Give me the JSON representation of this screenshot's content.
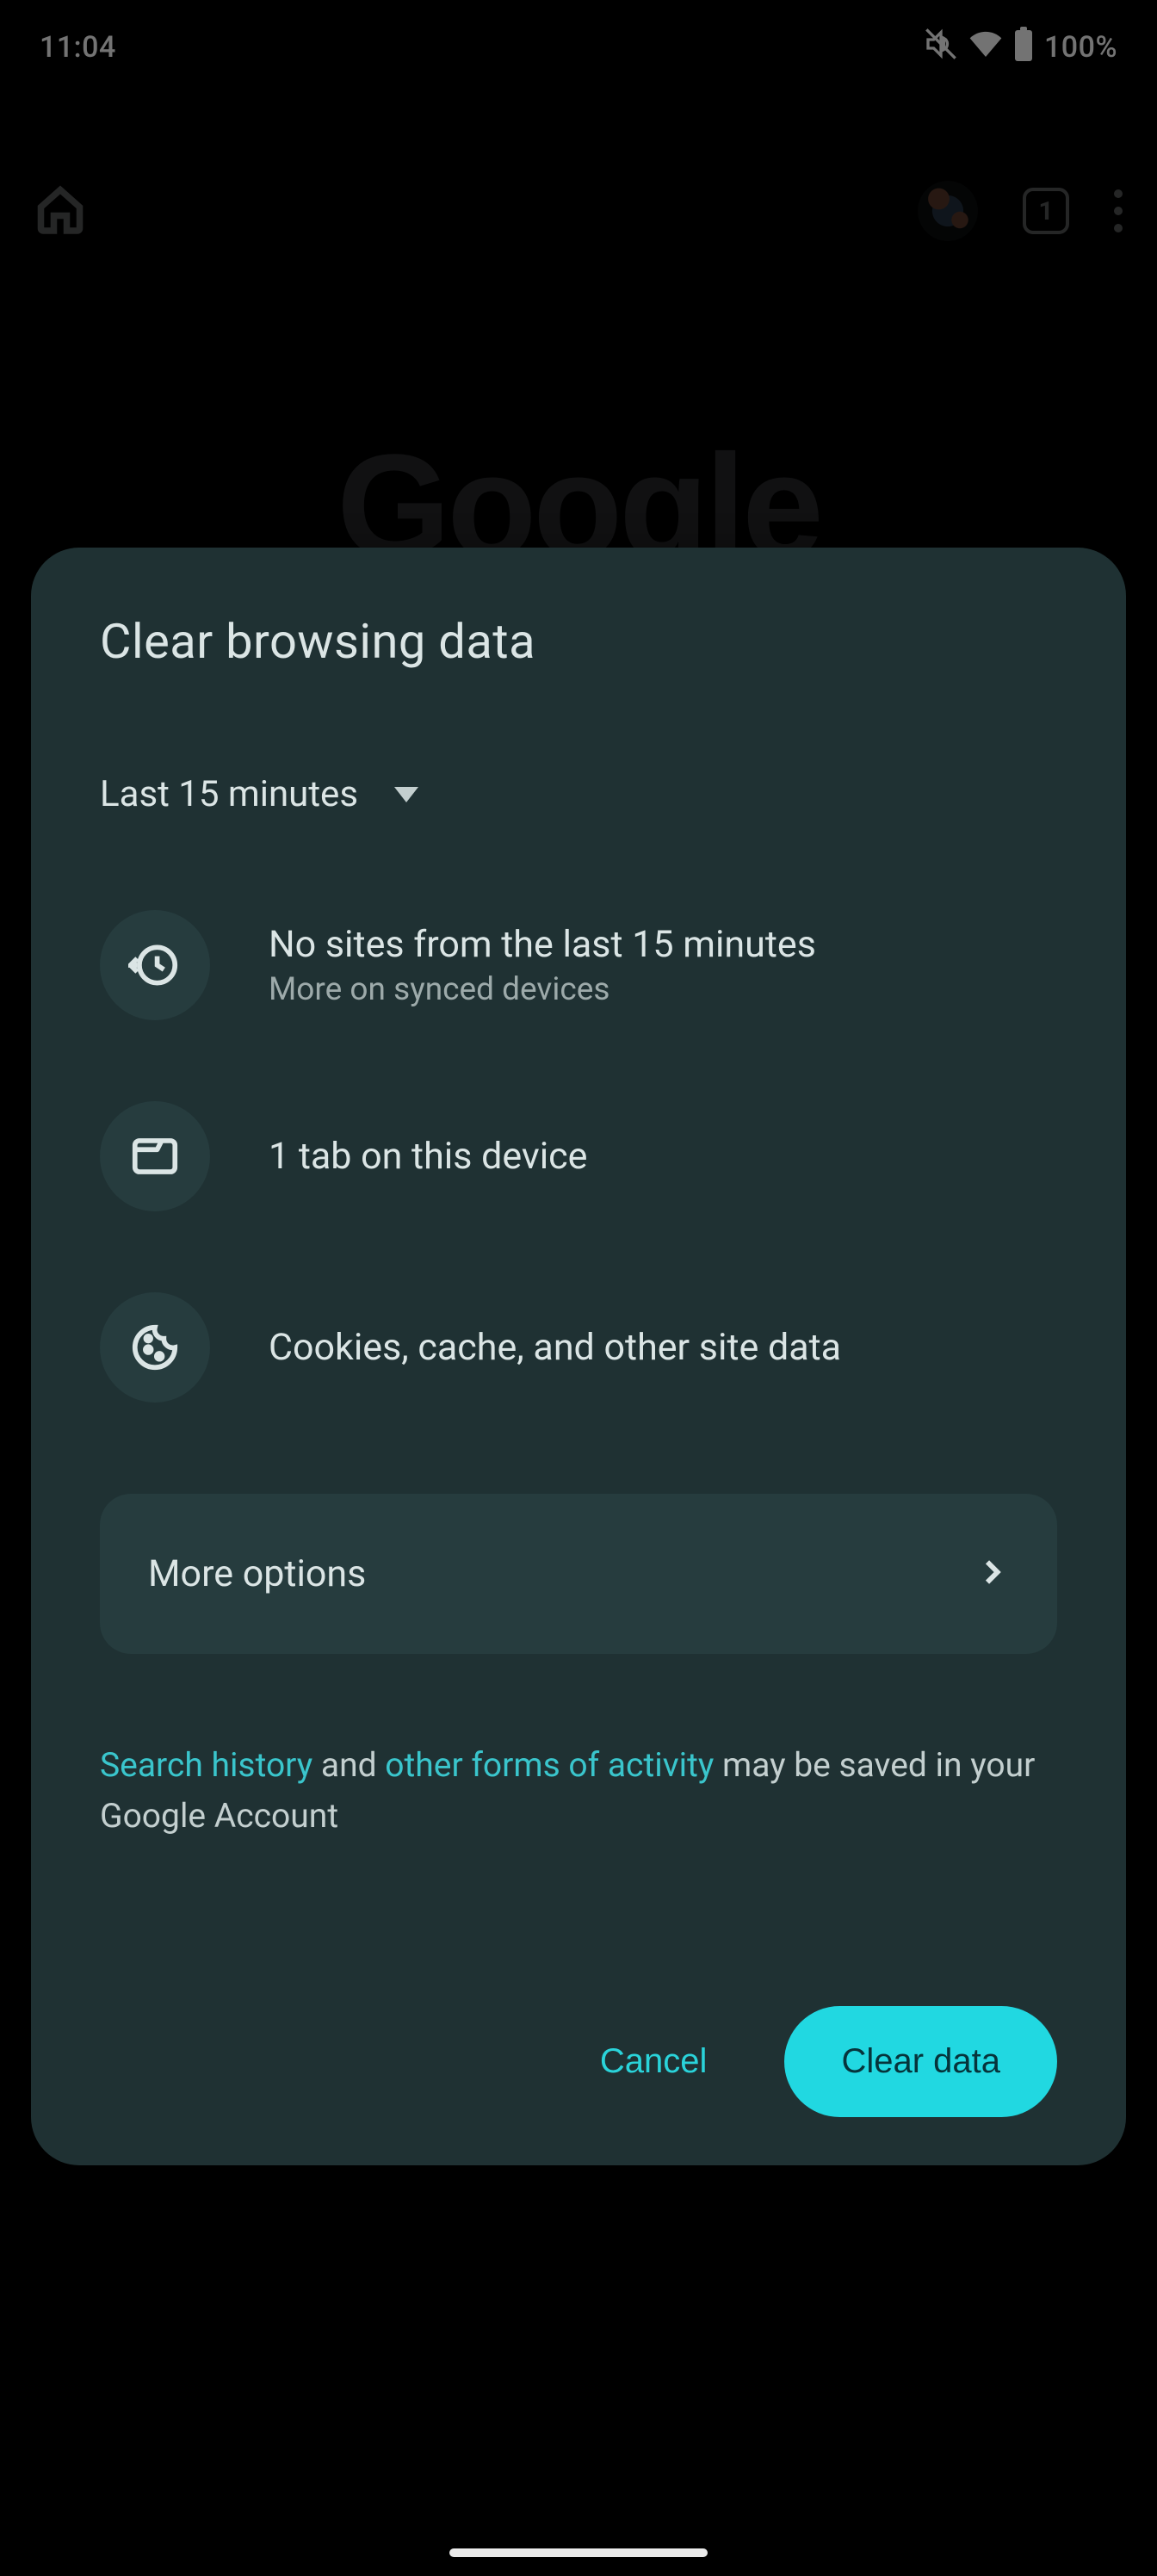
{
  "status": {
    "time": "11:04",
    "battery": "100%",
    "tab_count": "1"
  },
  "bg_logo": "Google",
  "dialog": {
    "title": "Clear browsing data",
    "time_range": "Last 15 minutes",
    "rows": [
      {
        "main": "No sites from the last 15 minutes",
        "sub": "More on synced devices"
      },
      {
        "main": "1 tab on this device",
        "sub": ""
      },
      {
        "main": "Cookies, cache, and other site data",
        "sub": ""
      }
    ],
    "more_options": "More options",
    "note": {
      "link1": "Search history",
      "mid1": " and ",
      "link2": "other forms of activity",
      "mid2": " may be saved in your Google Account"
    },
    "cancel": "Cancel",
    "confirm": "Clear data"
  }
}
